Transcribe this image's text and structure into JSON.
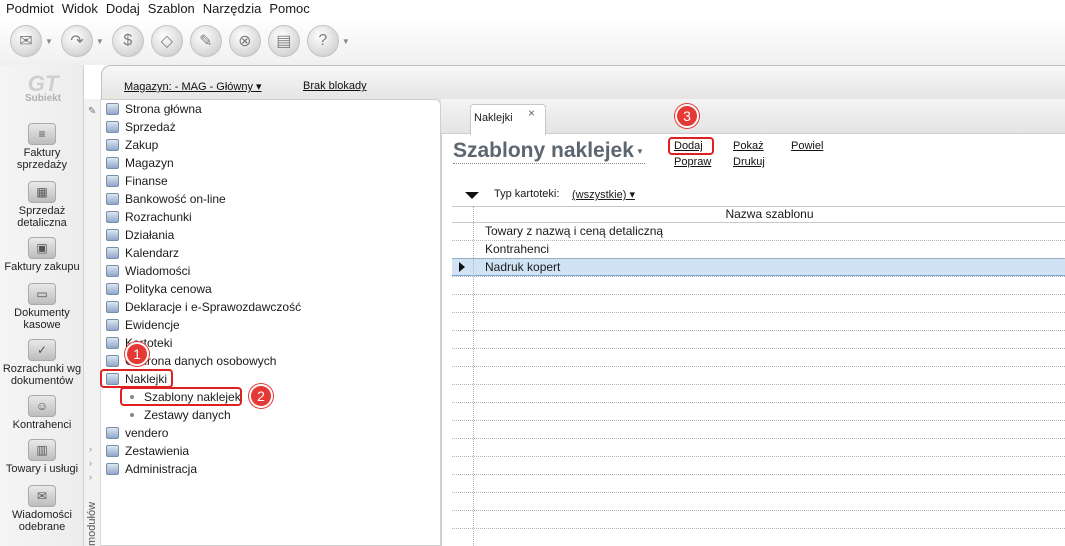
{
  "menu": [
    "Podmiot",
    "Widok",
    "Dodaj",
    "Szablon",
    "Narzędzia",
    "Pomoc"
  ],
  "toolbar_icons": [
    "document-icon",
    "redo-icon",
    "sales-icon",
    "eraser-icon",
    "tools-icon",
    "pills-icon",
    "printer-icon",
    "help-icon"
  ],
  "logo": {
    "text": "GT",
    "sub": "Subiekt"
  },
  "leftnav": [
    {
      "label": "Faktury sprzedaży",
      "icon": "coins-icon"
    },
    {
      "label": "Sprzedaż detaliczna",
      "icon": "cash-register-icon"
    },
    {
      "label": "Faktury zakupu",
      "icon": "boxes-icon"
    },
    {
      "label": "Dokumenty kasowe",
      "icon": "cash-icon"
    },
    {
      "label": "Rozrachunki wg dokumentów",
      "icon": "check-docs-icon"
    },
    {
      "label": "Kontrahenci",
      "icon": "person-icon"
    },
    {
      "label": "Towary i usługi",
      "icon": "goods-icon"
    },
    {
      "label": "Wiadomości odebrane",
      "icon": "mail-icon"
    }
  ],
  "warehouse": {
    "selector": "Magazyn: - MAG - Główny ▾",
    "lock": "Brak blokady"
  },
  "modules_label": "modułów",
  "tree": [
    "Strona główna",
    "Sprzedaż",
    "Zakup",
    "Magazyn",
    "Finanse",
    "Bankowość on-line",
    "Rozrachunki",
    "Działania",
    "Kalendarz",
    "Wiadomości",
    "Polityka cenowa",
    "Deklaracje i e-Sprawozdawczość",
    "Ewidencje",
    "Kartoteki",
    "Ochrona danych osobowych",
    "Naklejki"
  ],
  "tree_sub": [
    "Szablony naklejek",
    "Zestawy danych"
  ],
  "tree_after": [
    "vendero",
    "Zestawienia",
    "Administracja"
  ],
  "badges": [
    "1",
    "2",
    "3"
  ],
  "tab": {
    "label": "Naklejki",
    "close": "×"
  },
  "page_title": "Szablony naklejek",
  "actions": {
    "add": "Dodaj",
    "show": "Pokaż",
    "duplicate": "Powiel",
    "edit": "Popraw",
    "print": "Drukuj"
  },
  "filter": {
    "label": "Typ kartoteki:",
    "value": "(wszystkie) ▾"
  },
  "grid": {
    "header": "Nazwa szablonu",
    "rows": [
      "Towary z nazwą i ceną detaliczną",
      "Kontrahenci",
      "Nadruk kopert"
    ],
    "selected_index": 2
  }
}
